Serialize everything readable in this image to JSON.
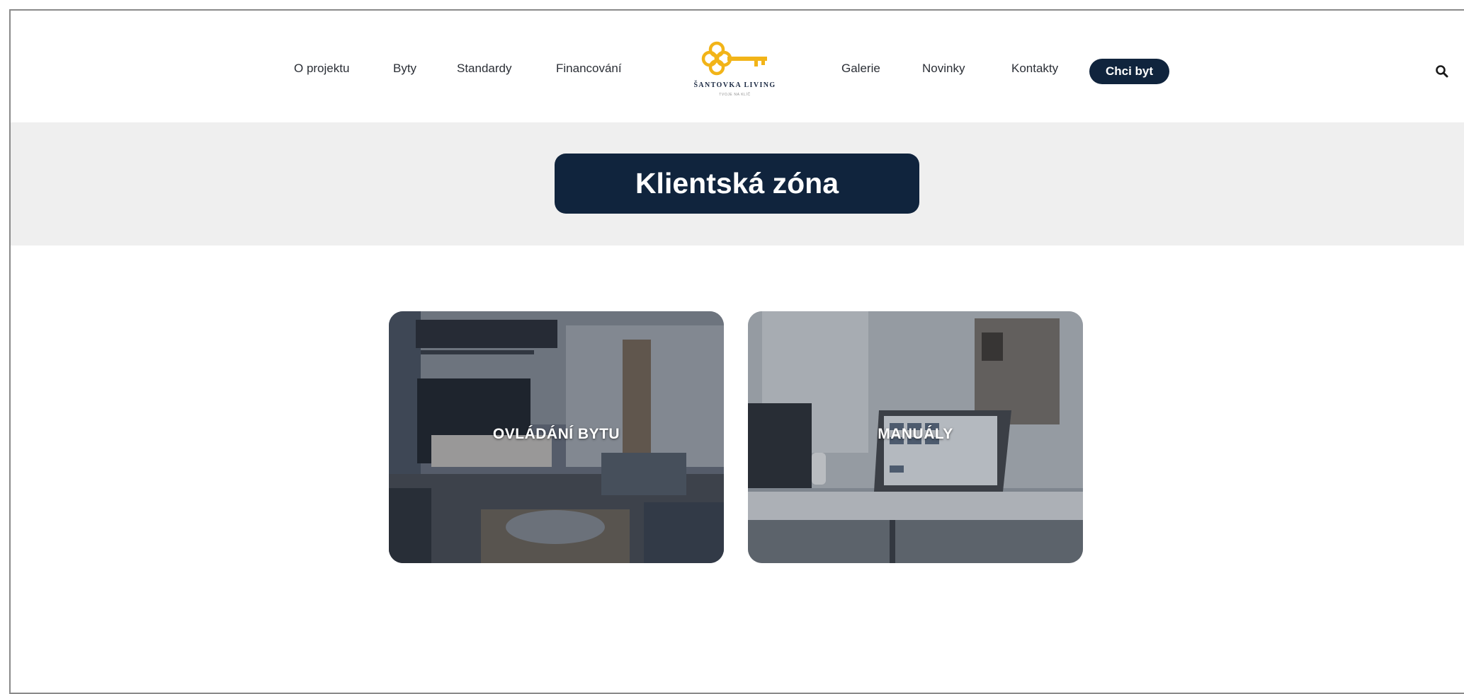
{
  "nav": {
    "left": [
      "O projektu",
      "Byty",
      "Standardy",
      "Financování"
    ],
    "right": [
      "Galerie",
      "Novinky",
      "Kontakty"
    ],
    "cta": "Chci byt"
  },
  "logo": {
    "name": "ŠANTOVKA LIVING",
    "tagline": "TVOJE NA KLÍČ",
    "accent_color": "#f2b418"
  },
  "icons": {
    "search": "search-icon",
    "logo_mark": "key-icon"
  },
  "hero": {
    "title": "Klientská zóna"
  },
  "cards": [
    {
      "label": "OVLÁDÁNÍ BYTU"
    },
    {
      "label": "MANUÁLY"
    }
  ],
  "colors": {
    "navy": "#10243d",
    "band": "#efefef"
  }
}
